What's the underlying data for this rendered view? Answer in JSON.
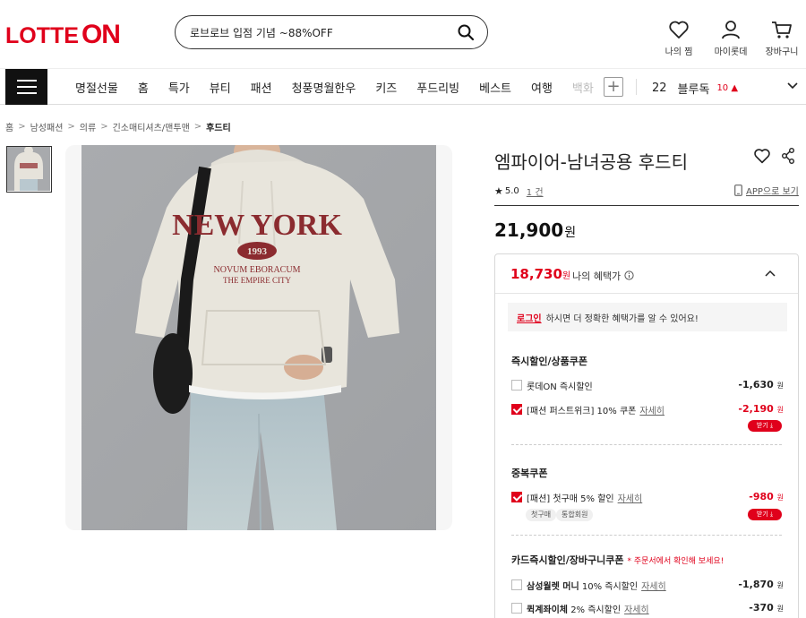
{
  "header": {
    "logo": {
      "part1": "LOTTE",
      "part2": "ON"
    },
    "search": {
      "value": "로브로브 입점 기념 ~88%OFF"
    },
    "wishlist_label": "나의 찜",
    "mypage_label": "마이롯데",
    "cart_label": "장바구니"
  },
  "nav": {
    "items": [
      "명절선물",
      "홈",
      "특가",
      "뷰티",
      "패션",
      "청풍명월한우",
      "키즈",
      "푸드리빙",
      "베스트",
      "여행",
      "백화"
    ],
    "plus": "+",
    "rank_number": "22",
    "rank_keyword": "블루독",
    "rank_delta": "10 ▲"
  },
  "breadcrumb": [
    "홈",
    "남성패션",
    "의류",
    "긴소매티셔츠/맨투맨",
    "후드티"
  ],
  "product": {
    "title": "엠파이어-남녀공용 후드티",
    "rating": "5.0",
    "review_count": "1 건",
    "app_link": "APP으로 보기",
    "price_value": "21,900",
    "price_unit": "원",
    "print": {
      "line1": "NEW YORK",
      "year": "1993",
      "line2": "NOVUM EBORACUM",
      "line3": "THE EMPIRE CITY"
    }
  },
  "benefit": {
    "price": "18,730",
    "unit": "원",
    "label": "나의 혜택가",
    "login_link": "로그인",
    "login_msg": "하시면 더 정확한 혜택가를 알 수 있어요!",
    "sections": {
      "s1": {
        "title": "즉시할인/상품쿠폰",
        "r1": {
          "text": "롯데ON 즉시할인",
          "amount": "-1,630",
          "unit": "원"
        },
        "r2": {
          "text": "[패션 퍼스트위크] 10% 쿠폰",
          "detail": "자세히",
          "amount": "-2,190",
          "unit": "원",
          "btn": "받기 ⤓"
        }
      },
      "s2": {
        "title": "중복쿠폰",
        "r1": {
          "text": "[패션] 첫구매 5% 할인",
          "detail": "자세히",
          "amount": "-980",
          "unit": "원",
          "btn": "받기 ⤓",
          "tag1": "첫구매",
          "tag2": "통합회원"
        }
      },
      "s3": {
        "title": "카드즉시할인/장바구니쿠폰",
        "note": "* 주문서에서 확인해 보세요!",
        "r1": {
          "text": "삼성월렛 머니",
          "text2": "10% 즉시할인",
          "detail": "자세히",
          "amount": "-1,870",
          "unit": "원"
        },
        "r2": {
          "text": "퀵계좌이체",
          "text2": "2% 즉시할인",
          "detail": "자세히",
          "amount": "-370",
          "unit": "원"
        }
      }
    }
  },
  "colors": {
    "brand": "#e0001b",
    "text": "#222222"
  }
}
